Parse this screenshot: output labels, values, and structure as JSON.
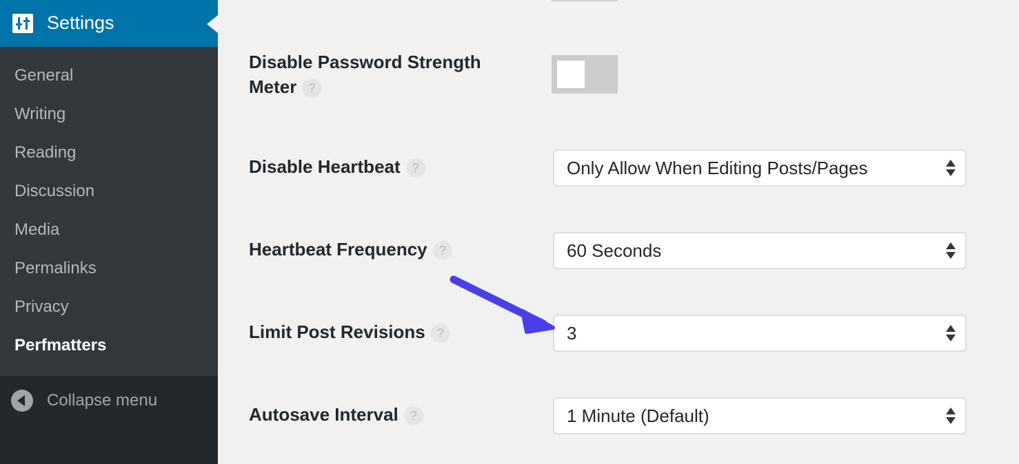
{
  "sidebar": {
    "header": {
      "label": "Settings",
      "icon": "settings-sliders-icon"
    },
    "items": [
      {
        "label": "General"
      },
      {
        "label": "Writing"
      },
      {
        "label": "Reading"
      },
      {
        "label": "Discussion"
      },
      {
        "label": "Media"
      },
      {
        "label": "Permalinks"
      },
      {
        "label": "Privacy"
      },
      {
        "label": "Perfmatters",
        "current": true
      }
    ],
    "collapse": {
      "label": "Collapse menu",
      "icon": "collapse-arrow-icon"
    }
  },
  "settings": {
    "help_glyph": "?",
    "password_meter": {
      "label_line1": "Disable Password Strength",
      "label_line2": "Meter",
      "toggle_on": false
    },
    "heartbeat": {
      "label": "Disable Heartbeat",
      "value": "Only Allow When Editing Posts/Pages"
    },
    "heartbeat_frequency": {
      "label": "Heartbeat Frequency",
      "value": "60 Seconds"
    },
    "post_revisions": {
      "label": "Limit Post Revisions",
      "value": "3"
    },
    "autosave": {
      "label": "Autosave Interval",
      "value": "1 Minute (Default)"
    }
  },
  "annotation": {
    "arrow_color": "#4b3ee8"
  },
  "colors": {
    "admin_blue": "#0073aa",
    "sidebar_bg": "#23282d",
    "submenu_bg": "#32373c"
  }
}
